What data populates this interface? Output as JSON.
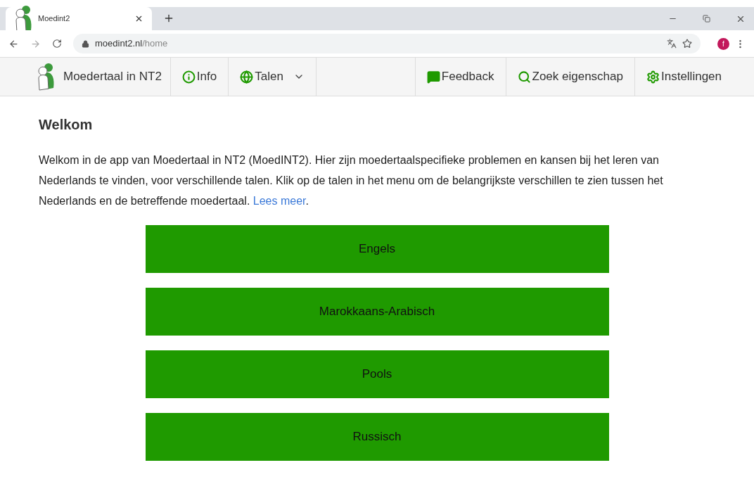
{
  "browser": {
    "tab_title": "Moedint2",
    "url_host": "moedint2.nl",
    "url_path": "/home",
    "profile_initial": "f"
  },
  "navbar": {
    "brand": "Moedertaal in NT2",
    "left_items": [
      {
        "kind": "info",
        "label": "Info"
      },
      {
        "kind": "languages",
        "label": "Talen"
      }
    ],
    "right_items": [
      {
        "kind": "feedback",
        "label": "Feedback"
      },
      {
        "kind": "search",
        "label": "Zoek eigenschap"
      },
      {
        "kind": "settings",
        "label": "Instellingen"
      }
    ]
  },
  "heading": "Welkom",
  "intro": "Welkom in de app van Moedertaal in NT2 (MoedINT2). Hier zijn moedertaalspecifieke problemen en kansen bij het leren van Nederlands te vinden, voor verschillende talen. Klik op de talen in het menu om de belangrijkste verschillen te zien tussen het Nederlands en de betreffende moedertaal.",
  "intro_link": "Lees meer",
  "intro_end": ".",
  "languages": [
    "Engels",
    "Marokkaans-Arabisch",
    "Pools",
    "Russisch"
  ]
}
